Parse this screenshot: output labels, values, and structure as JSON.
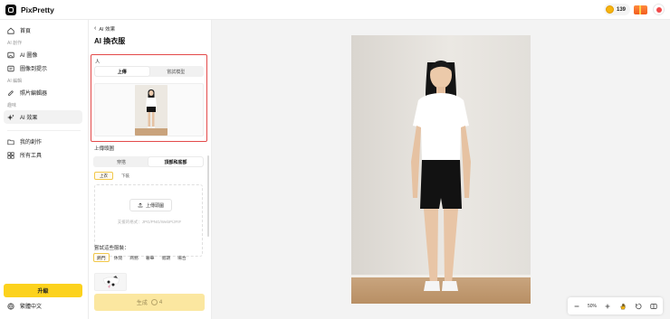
{
  "app": {
    "name": "PixPretty"
  },
  "header": {
    "credits": "139"
  },
  "sidebar": {
    "home": "首頁",
    "section_create": "AI 創作",
    "ai_image": "AI 圖像",
    "image_to_prompt": "圖像到提示",
    "section_edit": "AI 編輯",
    "photo_editor": "照片編輯器",
    "section_effects": "趣味",
    "ai_effects": "AI 效果",
    "my_creations": "我的創作",
    "all_tools": "所有工具",
    "upgrade": "升級",
    "language": "繁體中文"
  },
  "panel": {
    "back": "AI 效果",
    "title": "AI 換衣服",
    "person_label": "人",
    "person_tabs": [
      "上傳",
      "嘗試模型"
    ],
    "garment_label": "上傳頭圖",
    "garment_tabs": [
      "穿搭",
      "頂部和底部"
    ],
    "sub_tabs": [
      "上衣",
      "下裝"
    ],
    "upload_button": "上傳頭圖",
    "support_text": "支援的格式：JPG/PNG/WebP/JFIF",
    "try_label": "嘗試這些服裝：",
    "categories": [
      "熱門",
      "休閒",
      "商務",
      "奢華",
      "假期",
      "場合"
    ],
    "generate": "生成",
    "generate_cost": "4"
  },
  "canvas": {
    "zoom": "50%"
  },
  "colors": {
    "accent": "#fcd21d",
    "highlight_border": "#e34a4a"
  }
}
